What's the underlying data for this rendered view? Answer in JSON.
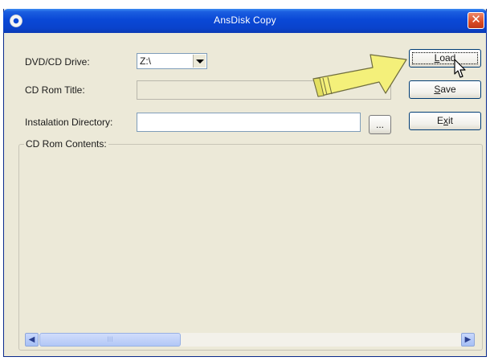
{
  "window": {
    "title": "AnsDisk Copy",
    "close_glyph": "✕",
    "app_icon": "disc-icon"
  },
  "form": {
    "drive_label": "DVD/CD Drive:",
    "drive_value": "Z:\\",
    "title_label": "CD Rom Title:",
    "title_value": "",
    "install_dir_label": "Instalation Directory:",
    "install_dir_value": "",
    "browse_label": "..."
  },
  "buttons": {
    "load_prefix": "",
    "load_accel": "L",
    "load_rest": "oad",
    "save_prefix": "",
    "save_accel": "S",
    "save_rest": "ave",
    "exit_prefix": "E",
    "exit_accel": "x",
    "exit_rest": "it"
  },
  "contents": {
    "group_title": "CD Rom Contents:",
    "scroll_left": "◀",
    "scroll_right": "▶",
    "thumb_grip": "III"
  },
  "overlay": {
    "arrow_color": "#f4f07a",
    "arrow_icon": "pointer-arrow-annotation",
    "cursor_icon": "mouse-cursor-icon"
  }
}
